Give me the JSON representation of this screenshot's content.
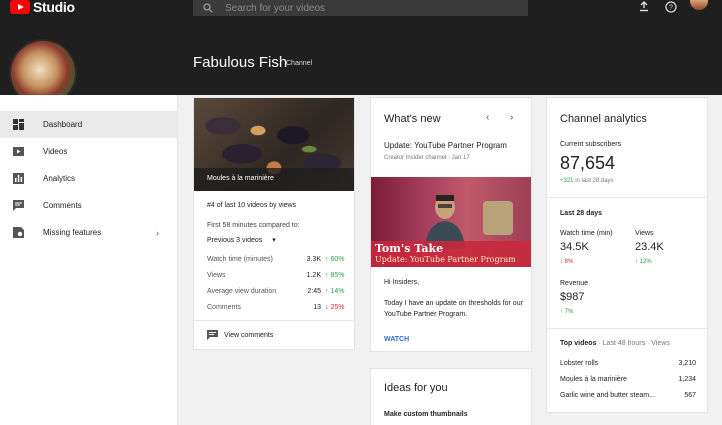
{
  "header": {
    "logo_text": "Studio",
    "search_placeholder": "Search for your videos",
    "channel_name": "Fabulous Fish",
    "channel_tag": "Channel"
  },
  "sidebar": {
    "items": [
      {
        "label": "Dashboard",
        "icon": "dashboard-icon",
        "active": true
      },
      {
        "label": "Videos",
        "icon": "video-icon"
      },
      {
        "label": "Analytics",
        "icon": "bar-chart-icon"
      },
      {
        "label": "Comments",
        "icon": "comment-icon"
      },
      {
        "label": "Missing features",
        "icon": "missing-features-icon",
        "chevron": "›"
      }
    ]
  },
  "video_card": {
    "thumbnail_caption": "Moules à la marinière",
    "rank": "#4 of last 10 videos by views",
    "compare_label": "First 58 minutes compared to:",
    "compare_select": "Previous 3 videos",
    "stats": [
      {
        "label": "Watch time (minutes)",
        "value": "3.3K",
        "delta": "60%",
        "dir": "up"
      },
      {
        "label": "Views",
        "value": "1.2K",
        "delta": "85%",
        "dir": "up"
      },
      {
        "label": "Average view duration",
        "value": "2:45",
        "delta": "14%",
        "dir": "up"
      },
      {
        "label": "Comments",
        "value": "13",
        "delta": "25%",
        "dir": "down"
      }
    ],
    "comments_link": "View comments"
  },
  "whats_new": {
    "title": "What's new",
    "headline": "Update: YouTube Partner Program",
    "meta": "Creator Insider channel · Jan 17",
    "image_title": "Tom's Take",
    "image_subtitle": "Update: YouTube Partner Program",
    "greeting": "Hi Insiders,",
    "body": "Today I have an update on thresholds for our YouTube Partner Program.",
    "cta": "WATCH"
  },
  "ideas": {
    "title": "Ideas for you",
    "subtitle": "Make custom thumbnails"
  },
  "analytics": {
    "title": "Channel analytics",
    "subs_label": "Current subscribers",
    "subs_value": "87,654",
    "subs_delta": "+321",
    "subs_delta_suffix": "in last 28 days",
    "period_label": "Last 28 days",
    "watch_label": "Watch time (min)",
    "watch_value": "34.5K",
    "watch_delta": "8%",
    "views_label": "Views",
    "views_value": "23.4K",
    "views_delta": "12%",
    "revenue_label": "Revenue",
    "revenue_value": "$987",
    "revenue_delta": "7%",
    "top_videos_label": "Top videos",
    "top_videos_meta": "· Last 48 hours · Views",
    "top_videos": [
      {
        "title": "Lobster rolls",
        "views": "3,210"
      },
      {
        "title": "Moules à la marinière",
        "views": "1,234"
      },
      {
        "title": "Garlic wine and butter steam...",
        "views": "567"
      }
    ]
  },
  "colors": {
    "header_bg": "#1f1f1f",
    "brand_red": "#ff0000",
    "up_green": "#2e9d4a",
    "down_red": "#d32f2f",
    "link_blue": "#2a6bc2"
  }
}
